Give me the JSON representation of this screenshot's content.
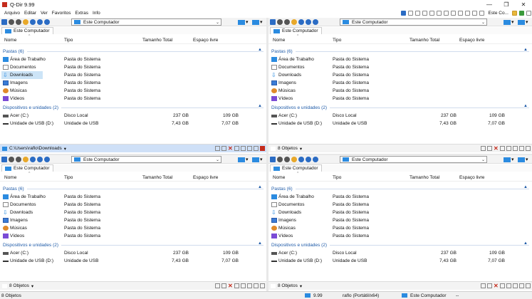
{
  "app": {
    "title": "Q-Dir 9.99"
  },
  "menu": [
    "Arquivo",
    "Editar",
    "Ver",
    "Favoritos",
    "Extras",
    "Info"
  ],
  "toolbar": {
    "label": "Este Co..."
  },
  "panes": [
    {
      "address": "Este Computador",
      "tab": "Este Computador",
      "status": "C:\\Users\\raflo\\Downloads",
      "status_kind": "path",
      "selected_row": 2
    },
    {
      "address": "Este Computador",
      "tab": "Este Computador",
      "status": "8 Objetos",
      "status_kind": "count",
      "selected_row": -1
    },
    {
      "address": "Este Computador",
      "tab": "Este Computador",
      "status": "8 Objetos",
      "status_kind": "count",
      "selected_row": -1
    },
    {
      "address": "Este Computador",
      "tab": "Este Computador",
      "status": "8 Objetos",
      "status_kind": "count",
      "selected_row": -1
    }
  ],
  "columns": {
    "name": "Nome",
    "type": "Tipo",
    "total": "Tamanho Total",
    "free": "Espaço livre"
  },
  "groups": {
    "folders": "Pastas (6)",
    "devices": "Dispositivos e unidades (2)"
  },
  "folders": [
    {
      "name": "Área de Trabalho",
      "type": "Pasta do Sistema",
      "icon": "desktop-icon"
    },
    {
      "name": "Documentos",
      "type": "Pasta do Sistema",
      "icon": "documents-icon"
    },
    {
      "name": "Downloads",
      "type": "Pasta do Sistema",
      "icon": "downloads-icon"
    },
    {
      "name": "Imagens",
      "type": "Pasta do Sistema",
      "icon": "pictures-icon"
    },
    {
      "name": "Músicas",
      "type": "Pasta do Sistema",
      "icon": "music-icon"
    },
    {
      "name": "Vídeos",
      "type": "Pasta do Sistema",
      "icon": "videos-icon"
    }
  ],
  "devices": [
    {
      "name": "Acer (C:)",
      "type": "Disco Local",
      "total": "237 GB",
      "free": "109 GB",
      "icon": "drive-icon"
    },
    {
      "name": "Unidade de USB (D:)",
      "type": "Unidade de USB",
      "total": "7,43 GB",
      "free": "7,07 GB",
      "icon": "usb-drive-icon"
    }
  ],
  "bottom_status": {
    "objects": "8 Objetos",
    "version": "9.99",
    "user": "raflo (Portátil/x64)",
    "location": "Este Computador",
    "dash": "--"
  }
}
